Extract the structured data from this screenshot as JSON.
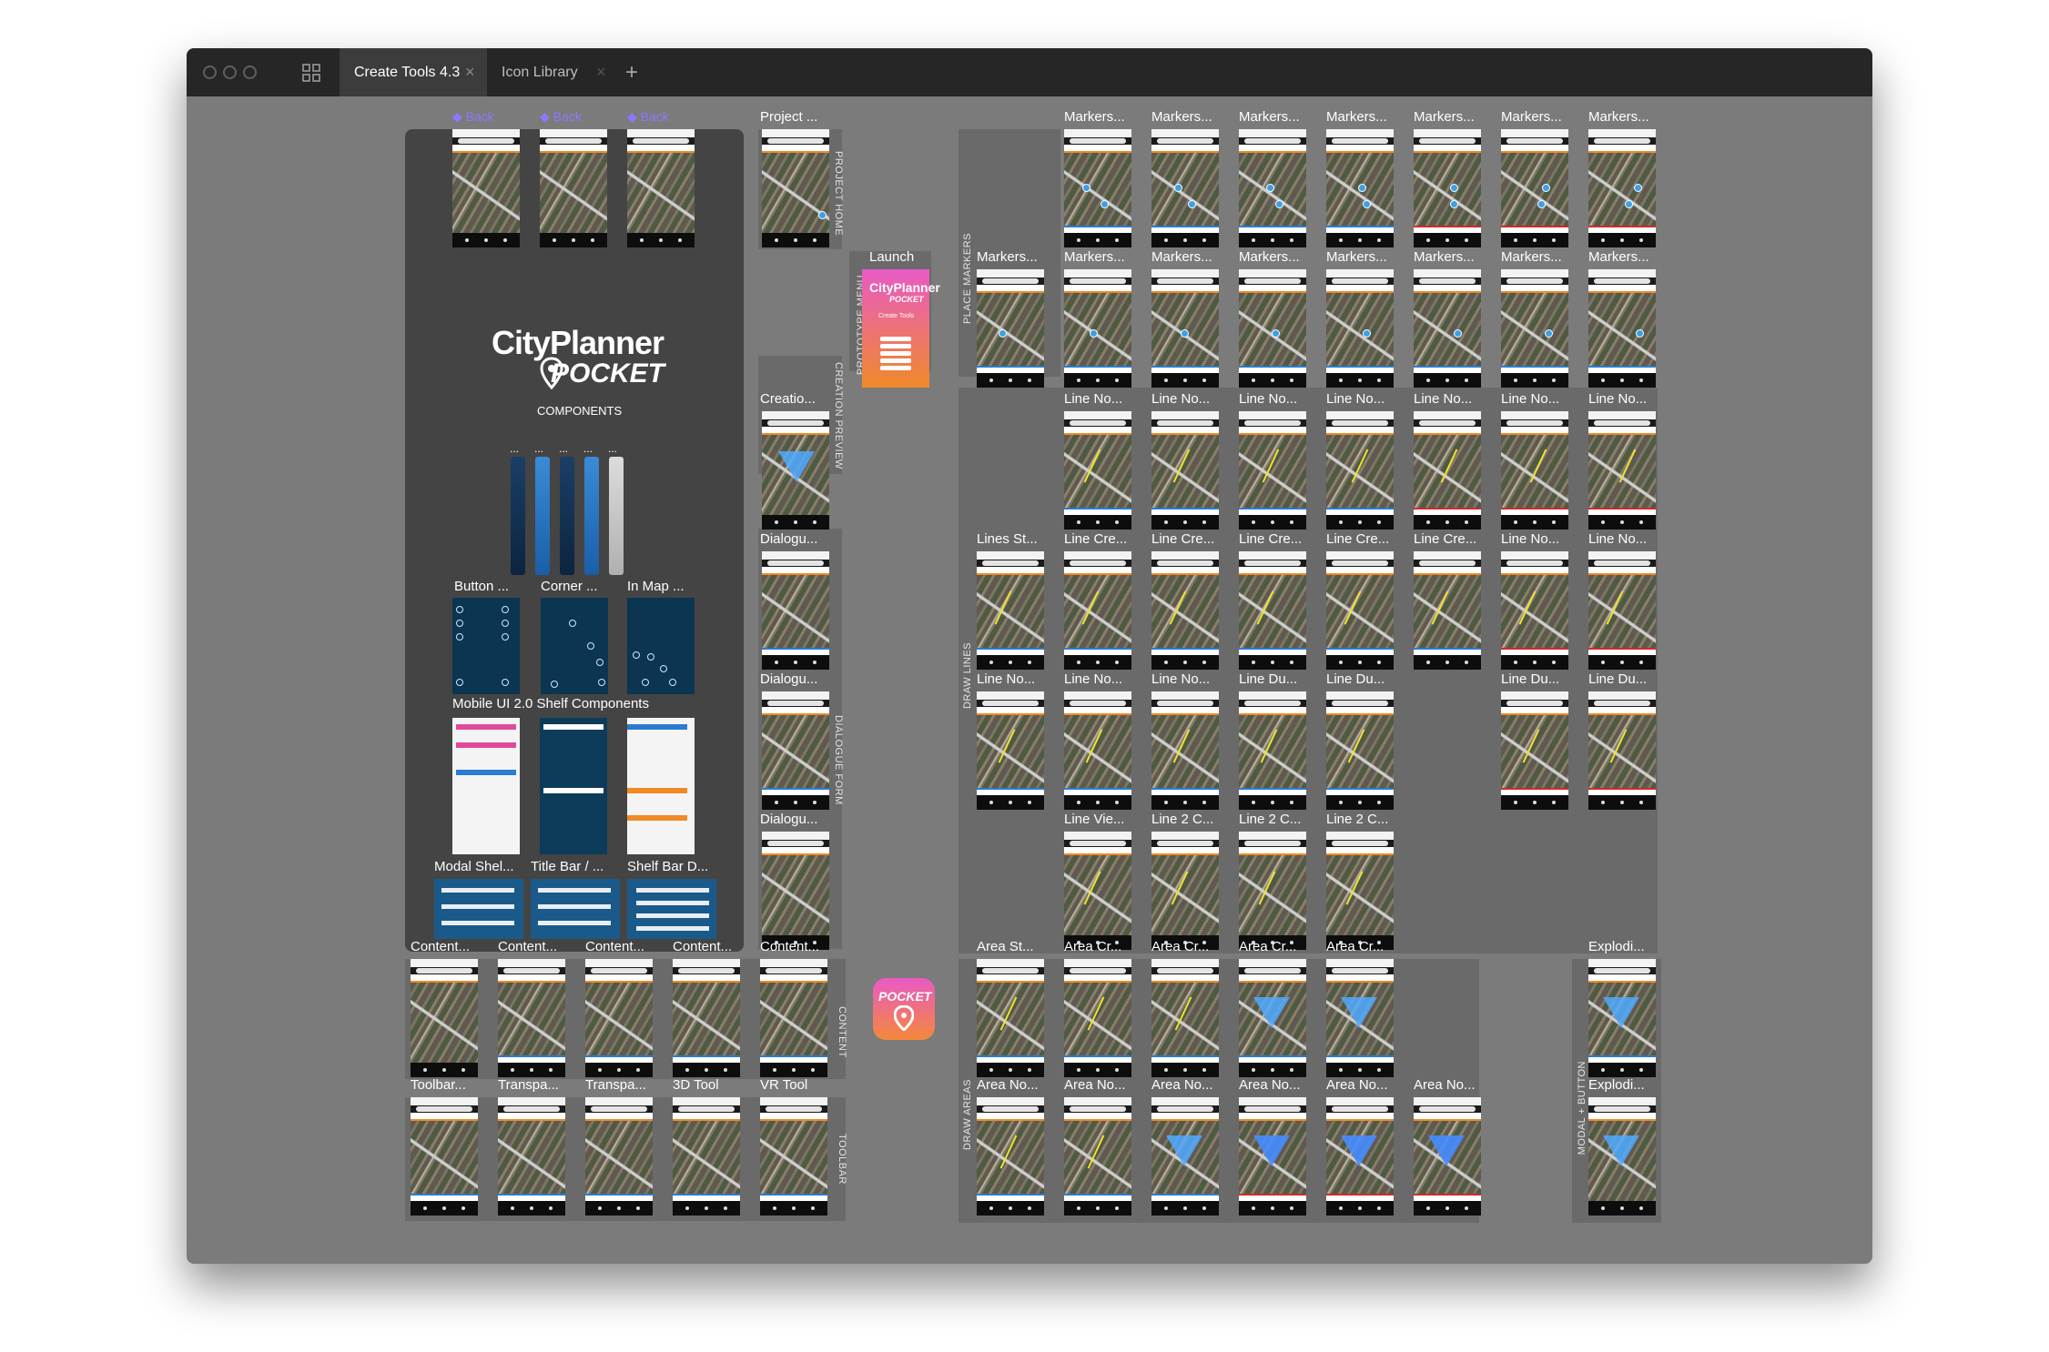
{
  "window": {
    "tabs": [
      {
        "label": "Create Tools 4.3",
        "active": true,
        "close": "×"
      },
      {
        "label": "Icon Library",
        "active": false,
        "close": "×"
      }
    ],
    "new_tab": "+",
    "grid_icon": "grid-icon"
  },
  "components_board": {
    "logo_line1": "CityPlanner",
    "logo_line2": "POCKET",
    "subtitle": "COMPONENTS",
    "back_links": [
      "◆ Back",
      "◆ Back",
      "◆ Back"
    ],
    "ellipses": [
      "...",
      "...",
      "...",
      "...",
      "..."
    ],
    "row_labels": [
      "Button ...",
      "Corner ...",
      "In Map ...",
      "Mobile UI 2.0 Shelf Components",
      "Modal Shel...",
      "Title Bar / ...",
      "Shelf Bar D..."
    ]
  },
  "section_labels": {
    "project_home": "PROJECT HOME",
    "prototype_menu": "PROTOTYPE MENU",
    "creation_preview": "CREATION PREVIEW",
    "dialogue_form": "DIALOGUE FORM",
    "content": "CONTENT",
    "toolbar": "TOOLBAR",
    "place_markers": "PLACE MARKERS",
    "draw_lines": "DRAW LINES",
    "draw_areas": "DRAW AREAS",
    "modal_button": "MODAL + BUTTON"
  },
  "center_frames": {
    "project": "Project ...",
    "launch": "Launch",
    "creation": "Creatio...",
    "dialogue": [
      "Dialogu...",
      "Dialogu...",
      "Dialogu..."
    ],
    "launch_logo": "CityPlanner",
    "launch_logo2": "POCKET",
    "launch_title": "Create Tools",
    "pocket_icon": "POCKET"
  },
  "bottom_frames": {
    "content_row": [
      "Content...",
      "Content...",
      "Content...",
      "Content...",
      "Content..."
    ],
    "toolbar_row": [
      "Toolbar...",
      "Transpa...",
      "Transpa...",
      "3D Tool",
      "VR Tool"
    ]
  },
  "markers": {
    "row1": [
      "Markers...",
      "Markers...",
      "Markers...",
      "Markers...",
      "Markers...",
      "Markers...",
      "Markers..."
    ],
    "row2": [
      "Markers...",
      "Markers...",
      "Markers...",
      "Markers...",
      "Markers...",
      "Markers...",
      "Markers...",
      "Markers..."
    ]
  },
  "lines": {
    "row1": [
      "Line No...",
      "Line No...",
      "Line No...",
      "Line No...",
      "Line No...",
      "Line No...",
      "Line No..."
    ],
    "row2": [
      "Lines St...",
      "Line Cre...",
      "Line Cre...",
      "Line Cre...",
      "Line Cre...",
      "Line Cre...",
      "Line No...",
      "Line No..."
    ],
    "row3": [
      "Line No...",
      "Line No...",
      "Line No...",
      "Line Du...",
      "Line Du...",
      "Line Du...",
      "Line Du..."
    ],
    "row4": [
      "Line Vie...",
      "Line 2 C...",
      "Line 2 C...",
      "Line 2 C..."
    ]
  },
  "areas": {
    "row1": [
      "Area St...",
      "Area Cr...",
      "Area Cr...",
      "Area Cr...",
      "Area Cr..."
    ],
    "row2": [
      "Area No...",
      "Area No...",
      "Area No...",
      "Area No...",
      "Area No...",
      "Area No..."
    ],
    "explode": [
      "Explodi...",
      "Explodi..."
    ]
  }
}
